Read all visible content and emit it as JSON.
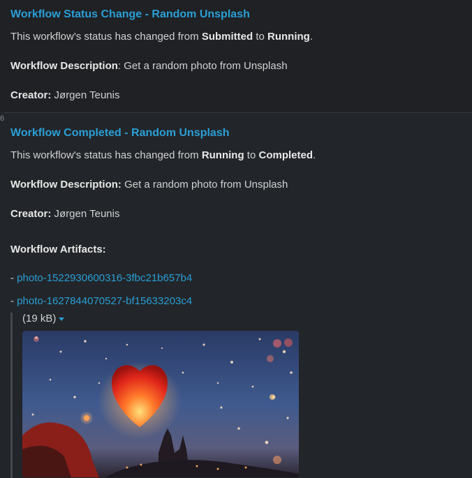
{
  "message1": {
    "title": "Workflow Status Change - Random Unsplash",
    "status_prefix": "This workflow's status has changed from ",
    "status_from": "Submitted",
    "status_to_word": " to ",
    "status_to": "Running",
    "status_end": ".",
    "desc_label": "Workflow Description",
    "desc_sep": ": ",
    "desc_value": "Get a random photo from Unsplash",
    "creator_label": "Creator:",
    "creator_value": " Jørgen Teunis"
  },
  "gutter_number": "6",
  "message2": {
    "title": "Workflow Completed - Random Unsplash",
    "status_prefix": "This workflow's status has changed from ",
    "status_from": "Running",
    "status_to_word": " to ",
    "status_to": "Completed",
    "status_end": ".",
    "desc_label": "Workflow Description:",
    "desc_value": " Get a random photo from Unsplash",
    "creator_label": "Creator:",
    "creator_value": " Jørgen Teunis",
    "artifacts_label": "Workflow Artifacts:",
    "artifacts": [
      {
        "prefix": "- ",
        "name": "photo-1522930600316-3fbc21b657b4"
      },
      {
        "prefix": "- ",
        "name": "photo-1627844070527-bf15633203c4"
      }
    ],
    "attachment": {
      "size": "(19 kB)",
      "caret_icon": "caret-down-icon",
      "image_subject": "heart-shaped sky lantern"
    }
  },
  "colors": {
    "background": "#222529",
    "link": "#2a9fd6",
    "text": "#d1d2d3"
  }
}
